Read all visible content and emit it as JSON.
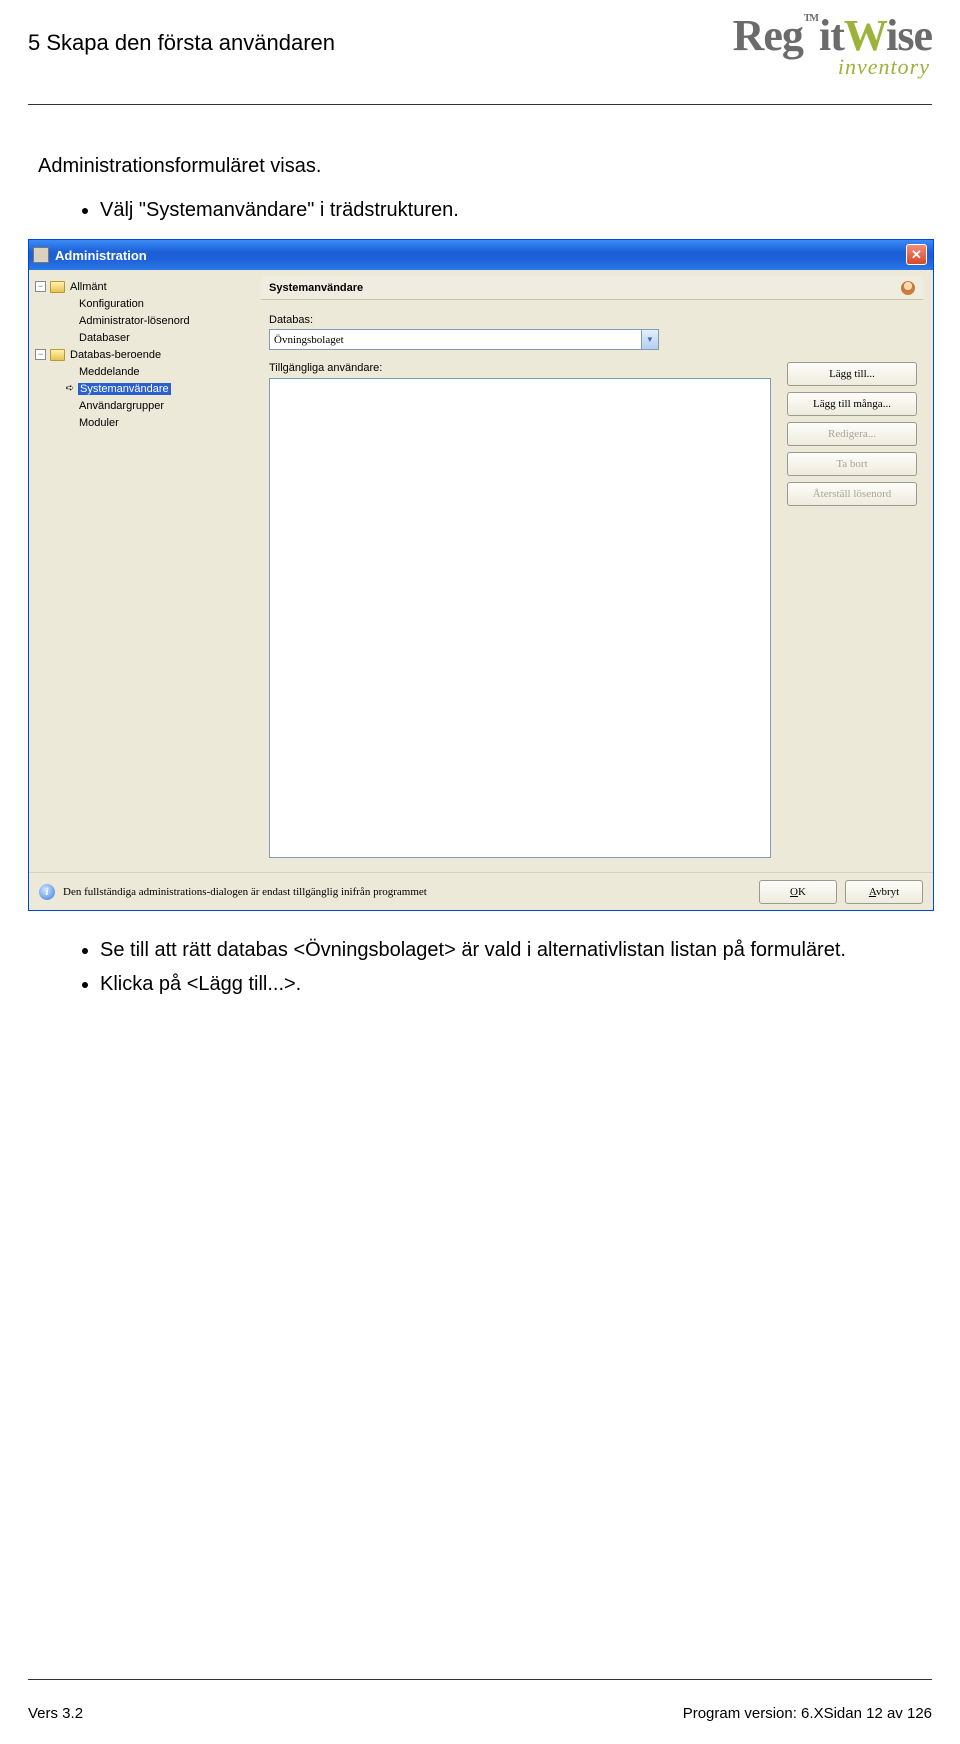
{
  "header": {
    "section_title": "5 Skapa den första användaren",
    "logo_brand_a": "Reg",
    "logo_brand_b": "it",
    "logo_brand_c": "W",
    "logo_brand_d": "ise",
    "logo_tm": "TM",
    "logo_sub": "inventory"
  },
  "body": {
    "intro": "Administrationsformuläret visas.",
    "bullets_before": [
      "Välj \"Systemanvändare\" i trädstrukturen."
    ],
    "bullets_after": [
      "Se till att rätt databas <Övningsbolaget> är vald i alternativlistan listan på formuläret.",
      "Klicka på <Lägg till...>."
    ]
  },
  "shot": {
    "title": "Administration",
    "tree": {
      "n0": "Allmänt",
      "n0_0": "Konfiguration",
      "n0_1": "Administrator-lösenord",
      "n0_2": "Databaser",
      "n1": "Databas-beroende",
      "n1_0": "Meddelande",
      "n1_1": "Systemanvändare",
      "n1_2": "Användargrupper",
      "n1_3": "Moduler"
    },
    "pane_header": "Systemanvändare",
    "db_label": "Databas:",
    "db_value": "Övningsbolaget",
    "users_label": "Tillgängliga användare:",
    "buttons": {
      "add": "Lägg till...",
      "add_many": "Lägg till många...",
      "edit": "Redigera...",
      "delete": "Ta bort",
      "reset_pw": "Återställ lösenord"
    },
    "footer_text": "Den fullständiga administrations-dialogen är endast tillgänglig inifrån programmet",
    "ok": "OK",
    "ok_u": "O",
    "ok_rest": "K",
    "cancel_u": "A",
    "cancel_rest": "vbryt"
  },
  "footer": {
    "left": "Vers 3.2",
    "right_a": "Program version:  6.X",
    "right_b": "Sidan 12 av 126"
  }
}
